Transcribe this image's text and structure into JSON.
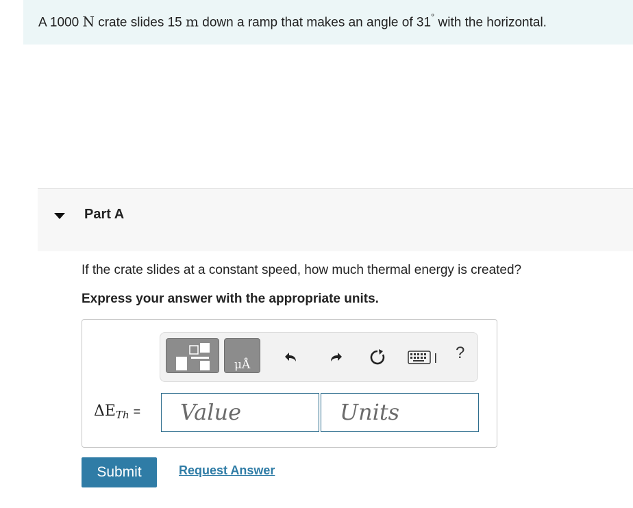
{
  "problem": {
    "text_a": "A 1000 ",
    "unit_force": "N",
    "text_b": " crate slides 15 ",
    "unit_length": "m",
    "text_c": " down a ramp that makes an angle of 31",
    "degree": "°",
    "text_d": " with the horizontal."
  },
  "part": {
    "title": "Part A",
    "question": "If the crate slides at a constant speed, how much thermal energy is created?",
    "instruction": "Express your answer with the appropriate units."
  },
  "toolbar": {
    "units_glyph": "μÅ",
    "help": "?",
    "icons": [
      "templates-icon",
      "units-icon",
      "undo-icon",
      "redo-icon",
      "reset-icon",
      "keyboard-icon",
      "help-icon"
    ]
  },
  "answer": {
    "variable": "ΔE",
    "subscript": "Th",
    "equals": "=",
    "value_placeholder": "Value",
    "units_placeholder": "Units"
  },
  "actions": {
    "submit": "Submit",
    "request_answer": "Request Answer"
  },
  "colors": {
    "banner_bg": "#ecf6f7",
    "accent": "#2f7ca6",
    "field_border": "#2f6e8e"
  }
}
